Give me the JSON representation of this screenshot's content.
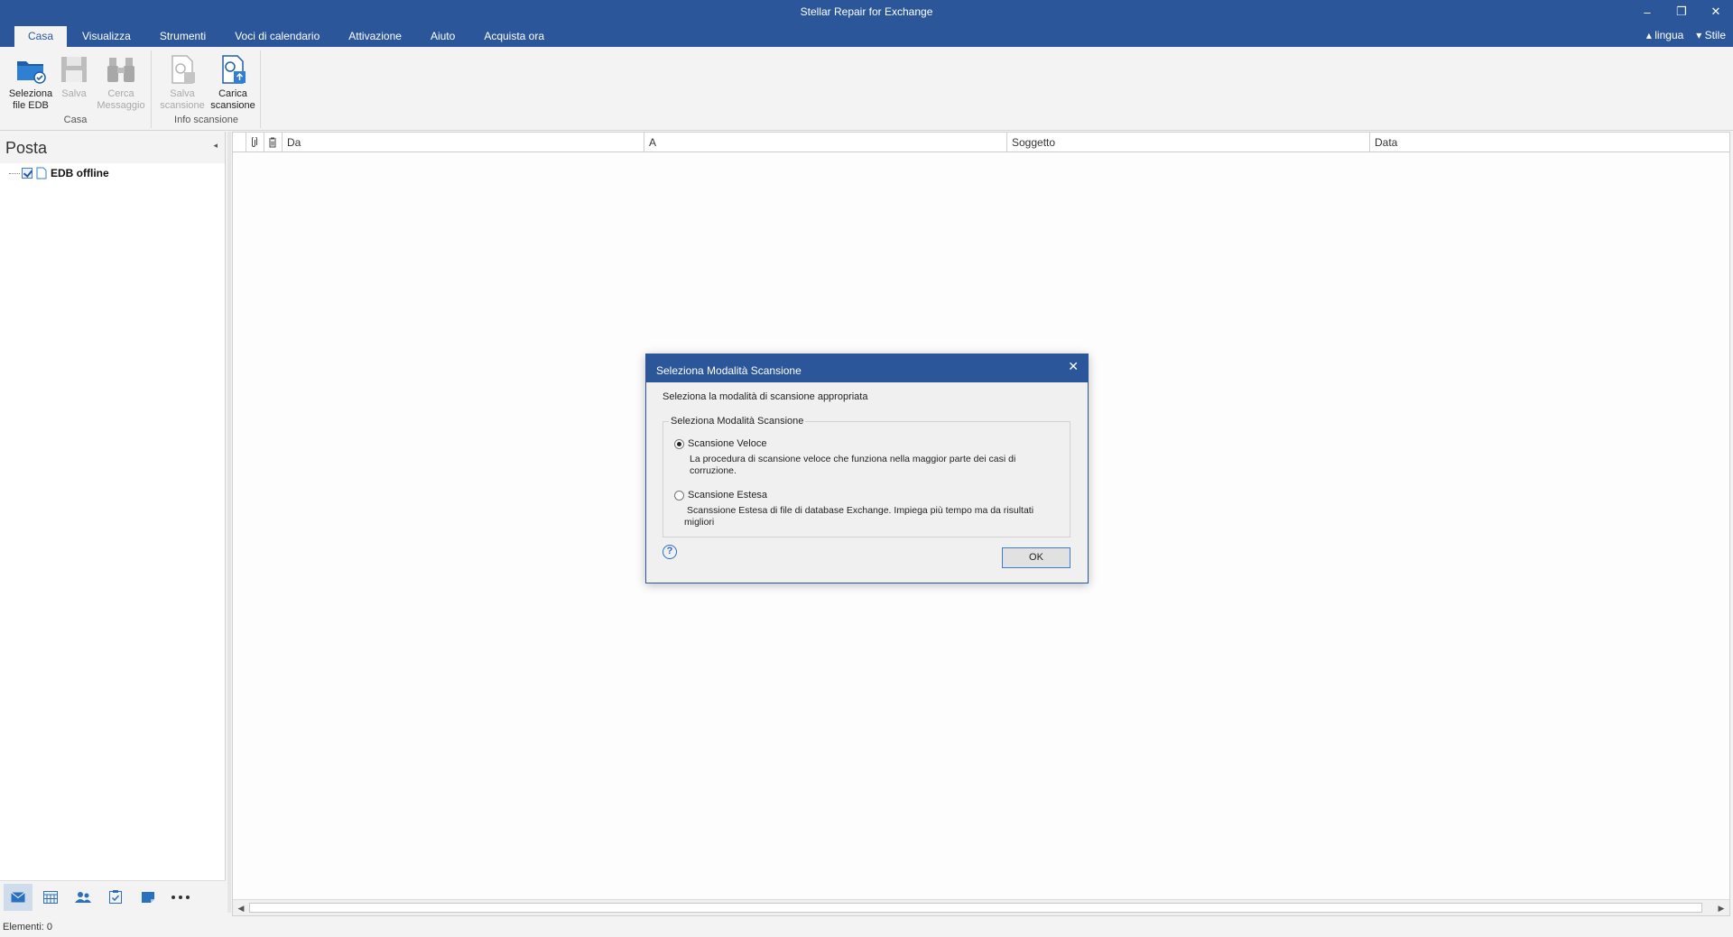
{
  "app": {
    "title": "Stellar Repair for Exchange"
  },
  "window_controls": {
    "minimize": "–",
    "restore": "❐",
    "close": "✕"
  },
  "menu": {
    "tabs": [
      "Casa",
      "Visualizza",
      "Strumenti",
      "Voci di calendario",
      "Attivazione",
      "Aiuto",
      "Acquista ora"
    ],
    "right": {
      "language": "lingua",
      "style": "Stile"
    }
  },
  "ribbon": {
    "groups": [
      {
        "label": "Casa",
        "buttons": [
          {
            "line1": "Seleziona",
            "line2": "file EDB",
            "icon": "folder-check-icon",
            "enabled": true
          },
          {
            "line1": "Salva",
            "line2": "",
            "icon": "floppy-disk-icon",
            "enabled": false
          },
          {
            "line1": "Cerca",
            "line2": "Messaggio",
            "icon": "binoculars-icon",
            "enabled": false
          }
        ]
      },
      {
        "label": "Info scansione",
        "buttons": [
          {
            "line1": "Salva",
            "line2": "scansione",
            "icon": "save-scan-icon",
            "enabled": false
          },
          {
            "line1": "Carica",
            "line2": "scansione",
            "icon": "load-scan-icon",
            "enabled": true
          }
        ]
      }
    ]
  },
  "left_panel": {
    "title": "Posta",
    "tree": [
      {
        "label": "EDB offline",
        "checked": true
      }
    ],
    "footer_icons": [
      "mail-icon",
      "calendar-icon",
      "contacts-icon",
      "tasks-icon",
      "notes-icon",
      "more-icon"
    ]
  },
  "list": {
    "columns": [
      "Da",
      "A",
      "Soggetto",
      "Data"
    ]
  },
  "status": {
    "items": "Elementi: 0"
  },
  "dialog": {
    "title": "Seleziona Modalità Scansione",
    "prompt": "Seleziona la modalità di scansione appropriata",
    "group_label": "Seleziona Modalità Scansione",
    "options": [
      {
        "label": "Scansione Veloce",
        "desc_line1": "La procedura di scansione veloce che funziona nella maggior parte dei casi di",
        "desc_line2": "corruzione.",
        "selected": true
      },
      {
        "label": "Scansione Estesa",
        "desc_line1": "Scanssione Estesa di file di database Exchange. Impiega più tempo ma da risultati",
        "desc_line2": "migliori",
        "selected": false
      }
    ],
    "ok_label": "OK",
    "help_glyph": "?"
  },
  "colors": {
    "accent": "#2b579a",
    "ribbon_bg": "#f3f3f3"
  }
}
